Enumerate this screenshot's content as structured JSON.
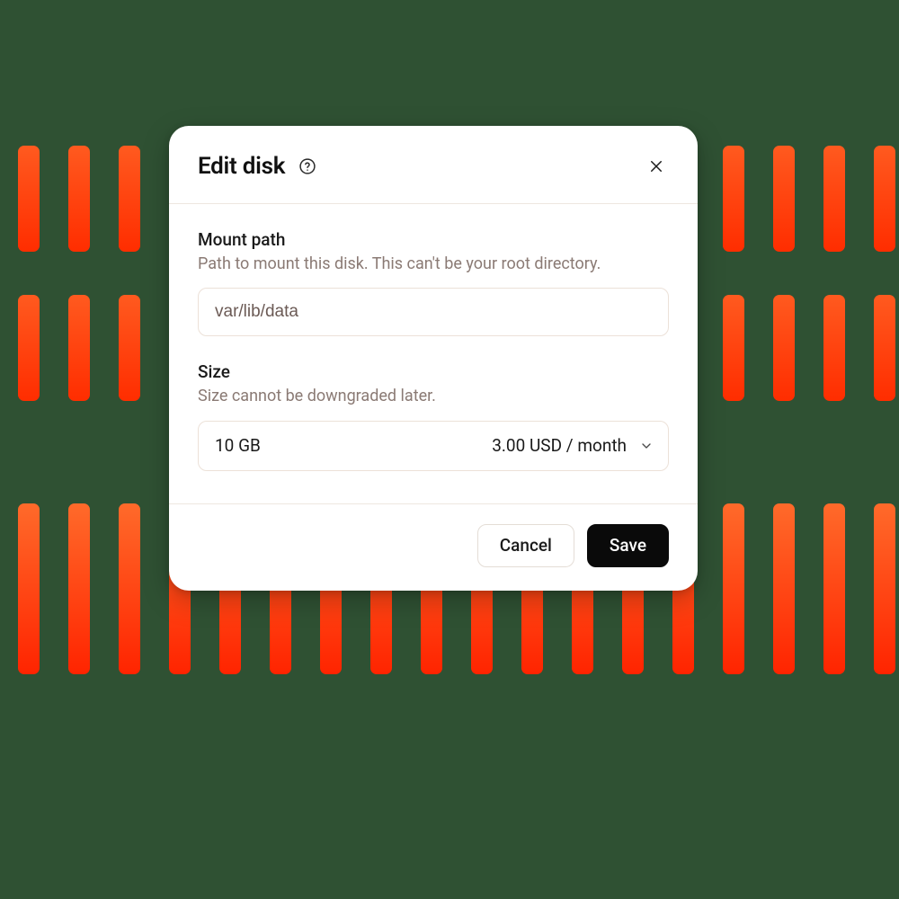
{
  "modal": {
    "title": "Edit disk",
    "fields": {
      "mount_path": {
        "label": "Mount path",
        "hint": "Path to mount this disk. This can't be your root directory.",
        "value": "var/lib/data"
      },
      "size": {
        "label": "Size",
        "hint": "Size cannot be downgraded later.",
        "selected": "10 GB",
        "price": "3.00 USD / month"
      }
    },
    "actions": {
      "cancel": "Cancel",
      "save": "Save"
    }
  }
}
